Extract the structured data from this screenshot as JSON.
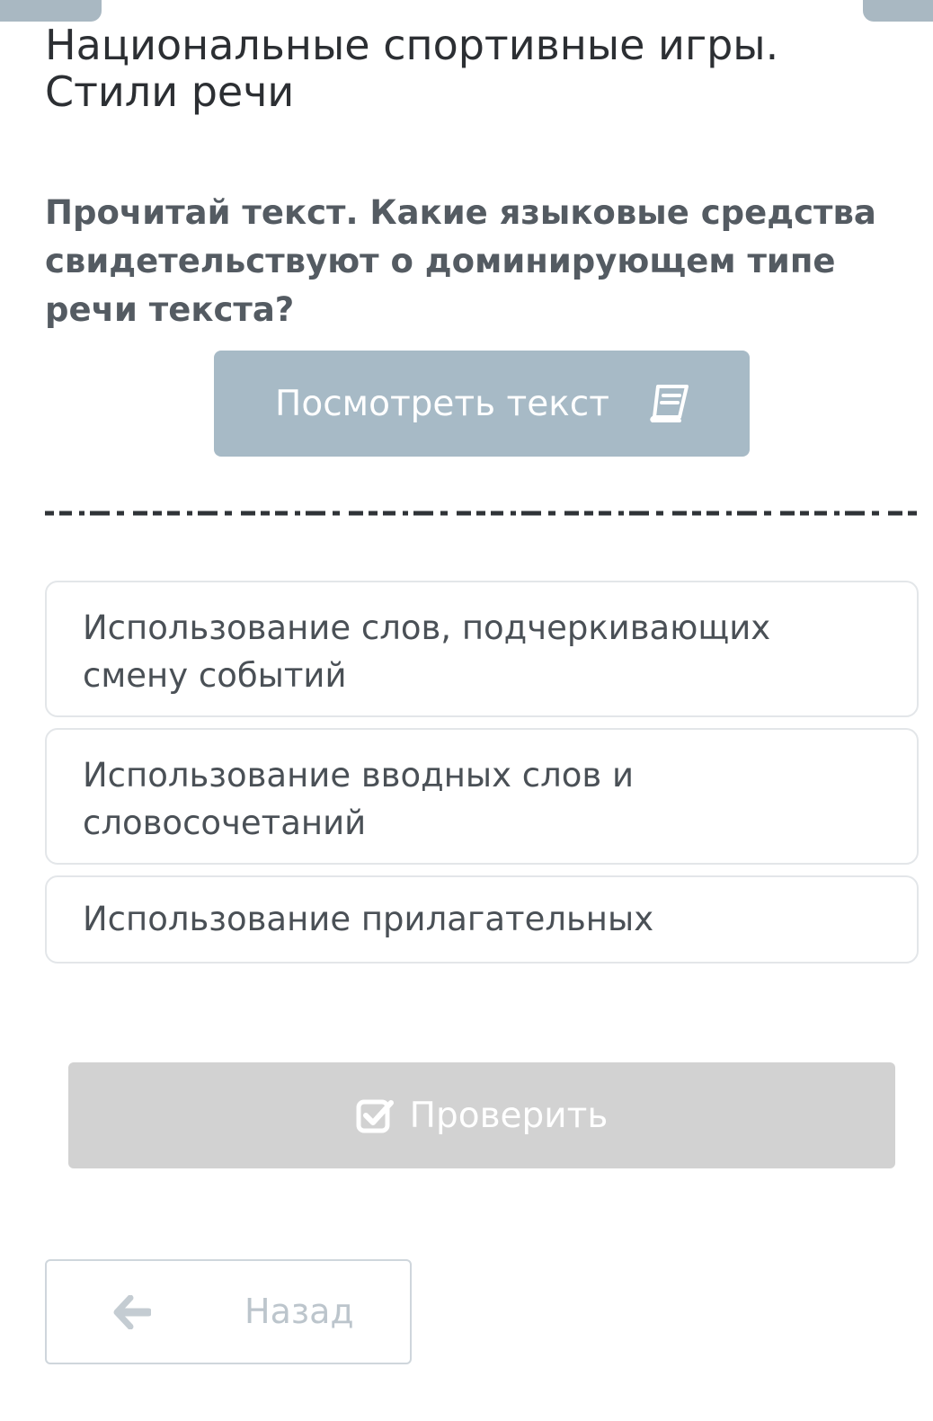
{
  "header": {
    "title": "Национальные спортивные игры. Стили речи"
  },
  "question": {
    "text": "Прочитай текст. Какие языковые средства свидетельствуют о доминирующем типе речи текста?"
  },
  "view_text_button": {
    "label": "Посмотреть текст",
    "icon": "book-icon"
  },
  "options": [
    {
      "label": "Использование слов, подчеркивающих смену событий"
    },
    {
      "label": "Использование вводных слов и словосочетаний"
    },
    {
      "label": "Использование прилагательных"
    }
  ],
  "check_button": {
    "label": "Проверить",
    "icon": "check-square-icon"
  },
  "back_button": {
    "label": "Назад",
    "icon": "arrow-left-icon"
  },
  "colors": {
    "primary_button": "#a7bac6",
    "disabled_button": "#d2d2d2",
    "option_border": "#e3e6e9",
    "title_text": "#2c2f33",
    "question_text": "#545b62"
  }
}
